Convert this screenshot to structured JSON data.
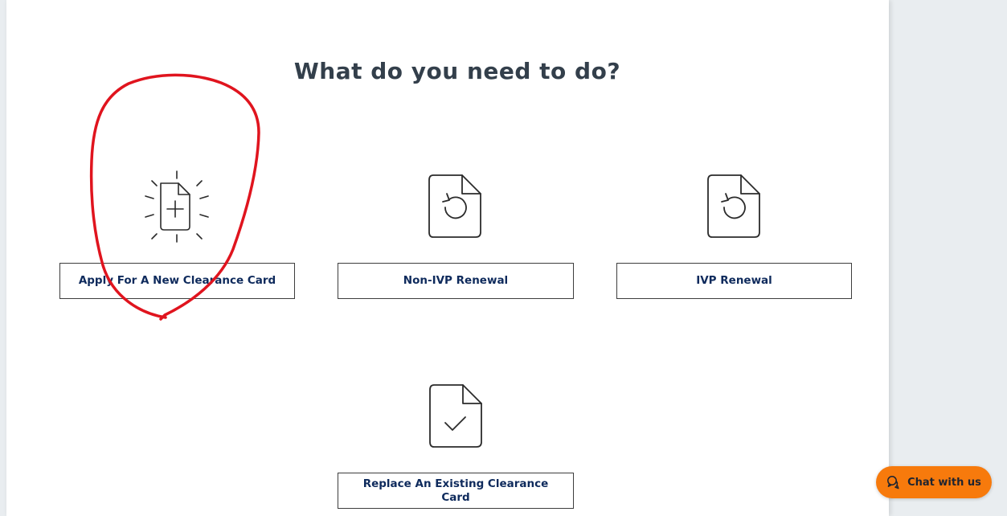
{
  "page": {
    "title": "What do you need to do?"
  },
  "options": [
    {
      "label": "Apply For A New Clearance Card",
      "icon": "new-document-icon"
    },
    {
      "label": "Non-IVP Renewal",
      "icon": "document-renew-icon"
    },
    {
      "label": "IVP Renewal",
      "icon": "document-renew-icon"
    },
    {
      "label": "Replace An Existing Clearance Card",
      "icon": "document-check-icon"
    }
  ],
  "chat": {
    "label": "Chat with us",
    "icon": "chat-bubbles-icon"
  },
  "colors": {
    "title": "#333f4b",
    "button_text": "#0e2a5c",
    "chat_background": "#f77a0c",
    "annotation": "#e0141e"
  }
}
